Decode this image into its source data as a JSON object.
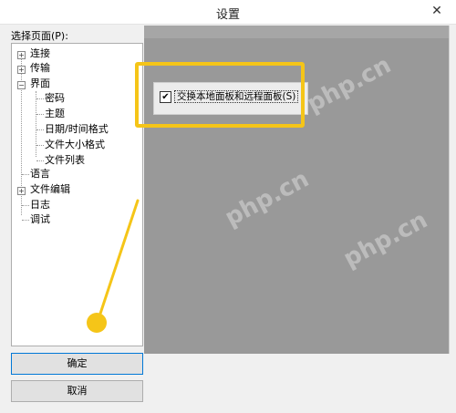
{
  "window": {
    "title": "设置",
    "close_glyph": "✕"
  },
  "left": {
    "label": "选择页面(P):",
    "tree": [
      {
        "label": "连接",
        "expander": "+"
      },
      {
        "label": "传输",
        "expander": "+"
      },
      {
        "label": "界面",
        "expander": "−"
      },
      {
        "label": "密码"
      },
      {
        "label": "主题"
      },
      {
        "label": "日期/时间格式"
      },
      {
        "label": "文件大小格式"
      },
      {
        "label": "文件列表"
      },
      {
        "label": "语言"
      },
      {
        "label": "文件编辑",
        "expander": "+"
      },
      {
        "label": "日志"
      },
      {
        "label": "调试"
      }
    ]
  },
  "buttons": {
    "ok": "确定",
    "cancel": "取消"
  },
  "right": {
    "checkbox_label": "交换本地面板和远程面板(S)",
    "checkbox_mark": "✔"
  },
  "watermark": "php.cn",
  "colors": {
    "highlight": "#f5c518",
    "panel_gray": "#999999"
  }
}
